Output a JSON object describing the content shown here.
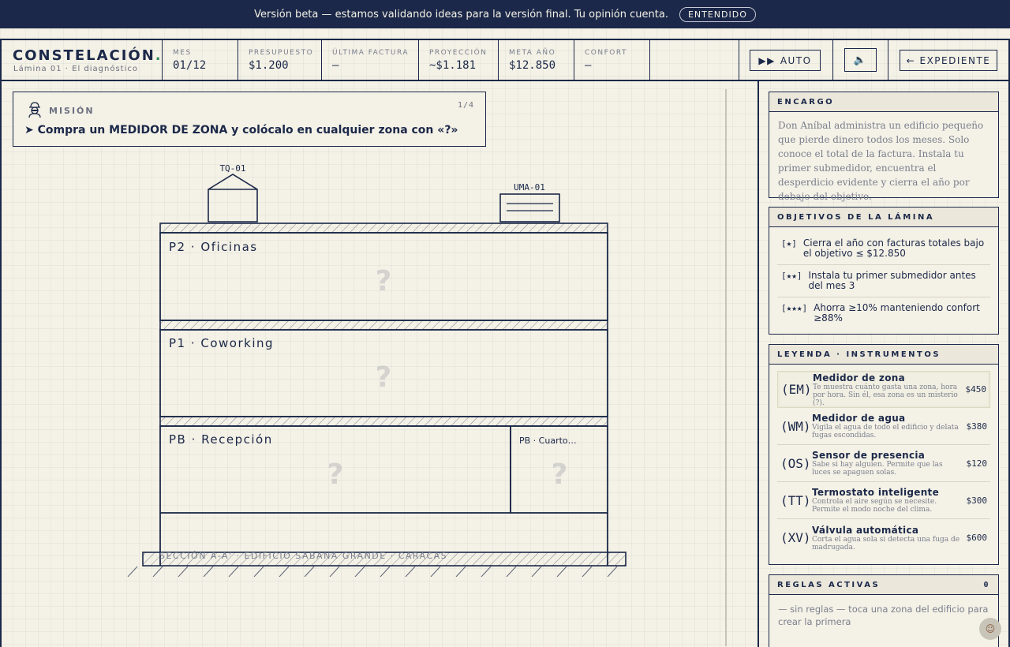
{
  "banner": {
    "text": "Versión beta — estamos validando ideas para la versión final. Tu opinión cuenta.",
    "button": "ENTENDIDO"
  },
  "brand": {
    "title": "CONSTELACIÓN",
    "dot": ".",
    "subtitle": "Lámina 01 · El diagnóstico"
  },
  "stats": {
    "mes": {
      "label": "MES",
      "value": "01/12"
    },
    "presupuesto": {
      "label": "PRESUPUESTO",
      "value": "$1.200"
    },
    "ultima": {
      "label": "ÚLTIMA FACTURA",
      "value": "—"
    },
    "proyeccion": {
      "label": "PROYECCIÓN",
      "value": "~$1.181"
    },
    "meta": {
      "label": "META AÑO",
      "value": "$12.850"
    },
    "confort": {
      "label": "CONFORT",
      "value": "—"
    }
  },
  "toolbar": {
    "auto_label": "AUTO",
    "auto_icon": "▶▶",
    "sound_icon": "🔈",
    "expediente_label": "← EXPEDIENTE"
  },
  "mission": {
    "label": "MISIÓN",
    "count": "1/4",
    "text": "➤ Compra un MEDIDOR DE ZONA y colócalo en cualquier zona con «?»"
  },
  "building": {
    "tank": "TQ-01",
    "uma": "UMA-01",
    "floors": [
      {
        "name": "P2 · Oficinas",
        "mark": "?"
      },
      {
        "name": "P1 · Coworking",
        "mark": "?"
      },
      {
        "name": "PB · Recepción",
        "mark": "?"
      },
      {
        "name": "PB · Cuarto…",
        "mark": "?"
      }
    ],
    "caption": "SECCIÓN A-A' · EDIFICIO SABANA GRANDE · CARACAS"
  },
  "encargo": {
    "title": "ENCARGO",
    "text": "Don Aníbal administra un edificio pequeño que pierde dinero todos los meses. Solo conoce el total de la factura. Instala tu primer submedidor, encuentra el desperdicio evidente y cierra el año por debajo del objetivo."
  },
  "objetivos": {
    "title": "OBJETIVOS DE LA LÁMINA",
    "items": [
      {
        "stars": "[★]",
        "text": "Cierra el año con facturas totales bajo el objetivo ≤ $12.850"
      },
      {
        "stars": "[★★]",
        "text": "Instala tu primer submedidor antes del mes 3"
      },
      {
        "stars": "[★★★]",
        "text": "Ahorra ≥10% manteniendo confort ≥88%"
      }
    ]
  },
  "leyenda": {
    "title": "LEYENDA · INSTRUMENTOS",
    "items": [
      {
        "code": "(EM)",
        "name": "Medidor de zona",
        "desc": "Te muestra cuánto gasta una zona, hora por hora. Sin él, esa zona es un misterio (?).",
        "price": "$450"
      },
      {
        "code": "(WM)",
        "name": "Medidor de agua",
        "desc": "Vigila el agua de todo el edificio y delata fugas escondidas.",
        "price": "$380"
      },
      {
        "code": "(OS)",
        "name": "Sensor de presencia",
        "desc": "Sabe si hay alguien. Permite que las luces se apaguen solas.",
        "price": "$120"
      },
      {
        "code": "(TT)",
        "name": "Termostato inteligente",
        "desc": "Controla el aire según se necesite. Permite el modo noche del clima.",
        "price": "$300"
      },
      {
        "code": "(XV)",
        "name": "Válvula automática",
        "desc": "Corta el agua sola si detecta una fuga de madrugada.",
        "price": "$600"
      }
    ]
  },
  "reglas": {
    "title": "REGLAS ACTIVAS",
    "count": "0",
    "empty": "— sin reglas — toca una zona del edificio para crear la primera"
  }
}
